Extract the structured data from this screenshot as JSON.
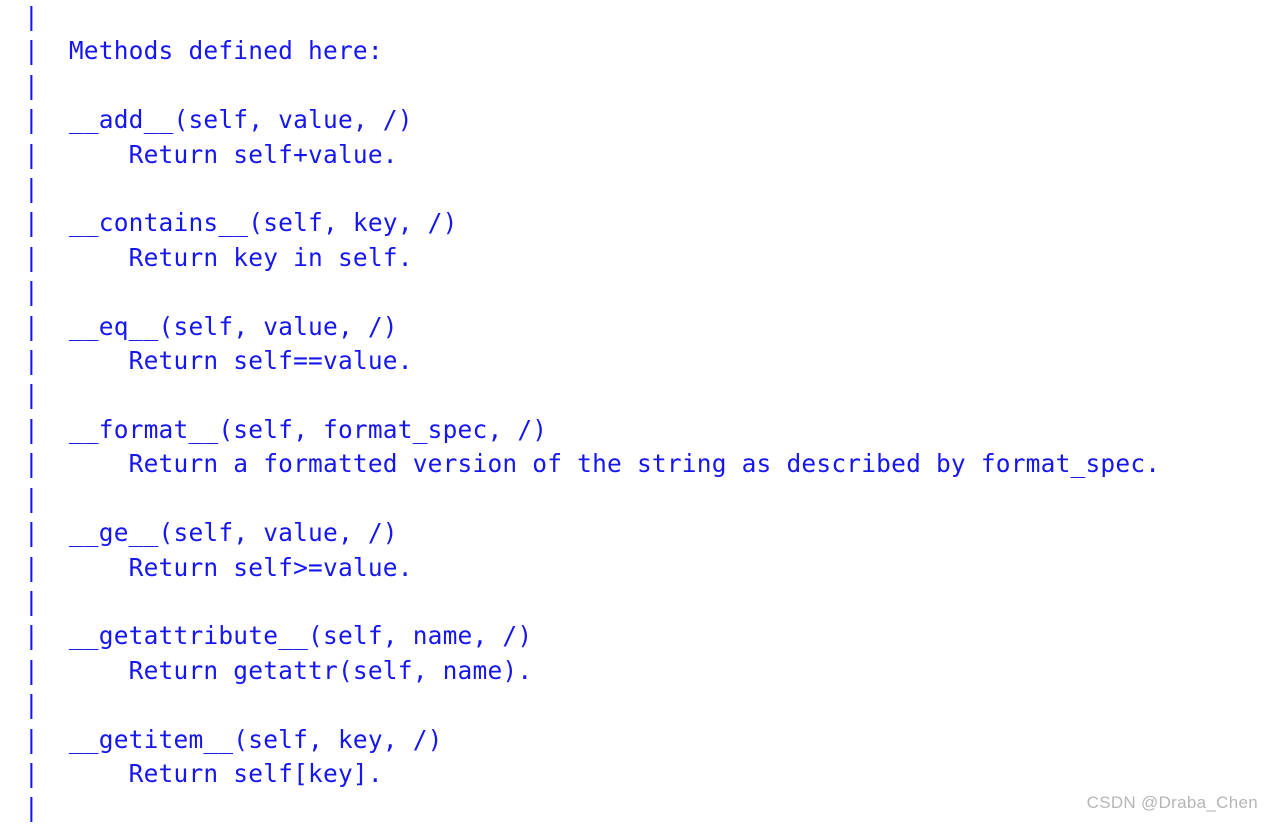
{
  "doc": {
    "lines": [
      "|",
      "|  Methods defined here:",
      "|",
      "|  __add__(self, value, /)",
      "|      Return self+value.",
      "|",
      "|  __contains__(self, key, /)",
      "|      Return key in self.",
      "|",
      "|  __eq__(self, value, /)",
      "|      Return self==value.",
      "|",
      "|  __format__(self, format_spec, /)",
      "|      Return a formatted version of the string as described by format_spec.",
      "|",
      "|  __ge__(self, value, /)",
      "|      Return self>=value.",
      "|",
      "|  __getattribute__(self, name, /)",
      "|      Return getattr(self, name).",
      "|",
      "|  __getitem__(self, key, /)",
      "|      Return self[key].",
      "|"
    ]
  },
  "watermark": "CSDN @Draba_Chen"
}
